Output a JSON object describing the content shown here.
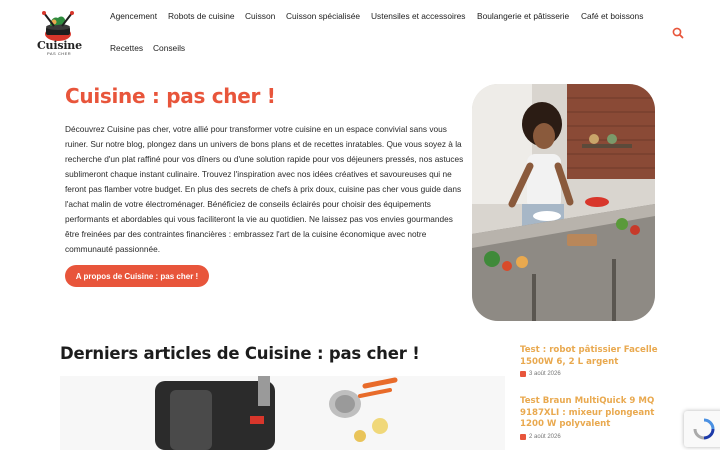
{
  "brand": {
    "name": "Cuisine",
    "tagline": "PAS CHER"
  },
  "nav": {
    "items": [
      "Agencement",
      "Robots de cuisine",
      "Cuisson",
      "Cuisson spécialisée",
      "Ustensiles et accessoires",
      "Boulangerie et pâtisserie",
      "Café et boissons",
      "Recettes",
      "Conseils"
    ]
  },
  "hero": {
    "title": "Cuisine : pas cher !",
    "body": "Découvrez Cuisine pas cher, votre allié pour transformer votre cuisine en un espace convivial sans vous ruiner. Sur notre blog, plongez dans un univers de bons plans et de recettes inratables. Que vous soyez à la recherche d'un plat raffiné pour vos dîners ou d'une solution rapide pour vos déjeuners pressés, nos astuces sublimeront chaque instant culinaire. Trouvez l'inspiration avec nos idées créatives et savoureuses qui ne feront pas flamber votre budget. En plus des secrets de chefs à prix doux, cuisine pas cher vous guide dans l'achat malin de votre électroménager. Bénéficiez de conseils éclairés pour choisir des équipements performants et abordables qui vous faciliteront la vie au quotidien. Ne laissez pas vos envies gourmandes être freinées par des contraintes financières : embrassez l'art de la cuisine économique avec notre communauté passionnée.",
    "button_label": "A propos de Cuisine : pas cher !"
  },
  "latest": {
    "title": "Derniers articles de Cuisine : pas cher !",
    "posts": [
      {
        "title": "Test : robot pâtissier Facelle 1500W 6, 2 L argent",
        "date": "3 août 2026"
      },
      {
        "title": "Test Braun MultiQuick 9 MQ 9187XLI : mixeur plongeant 1200 W polyvalent",
        "date": "2 août 2026"
      }
    ]
  },
  "colors": {
    "accent": "#e8553b",
    "side_title": "#e9a94f"
  }
}
